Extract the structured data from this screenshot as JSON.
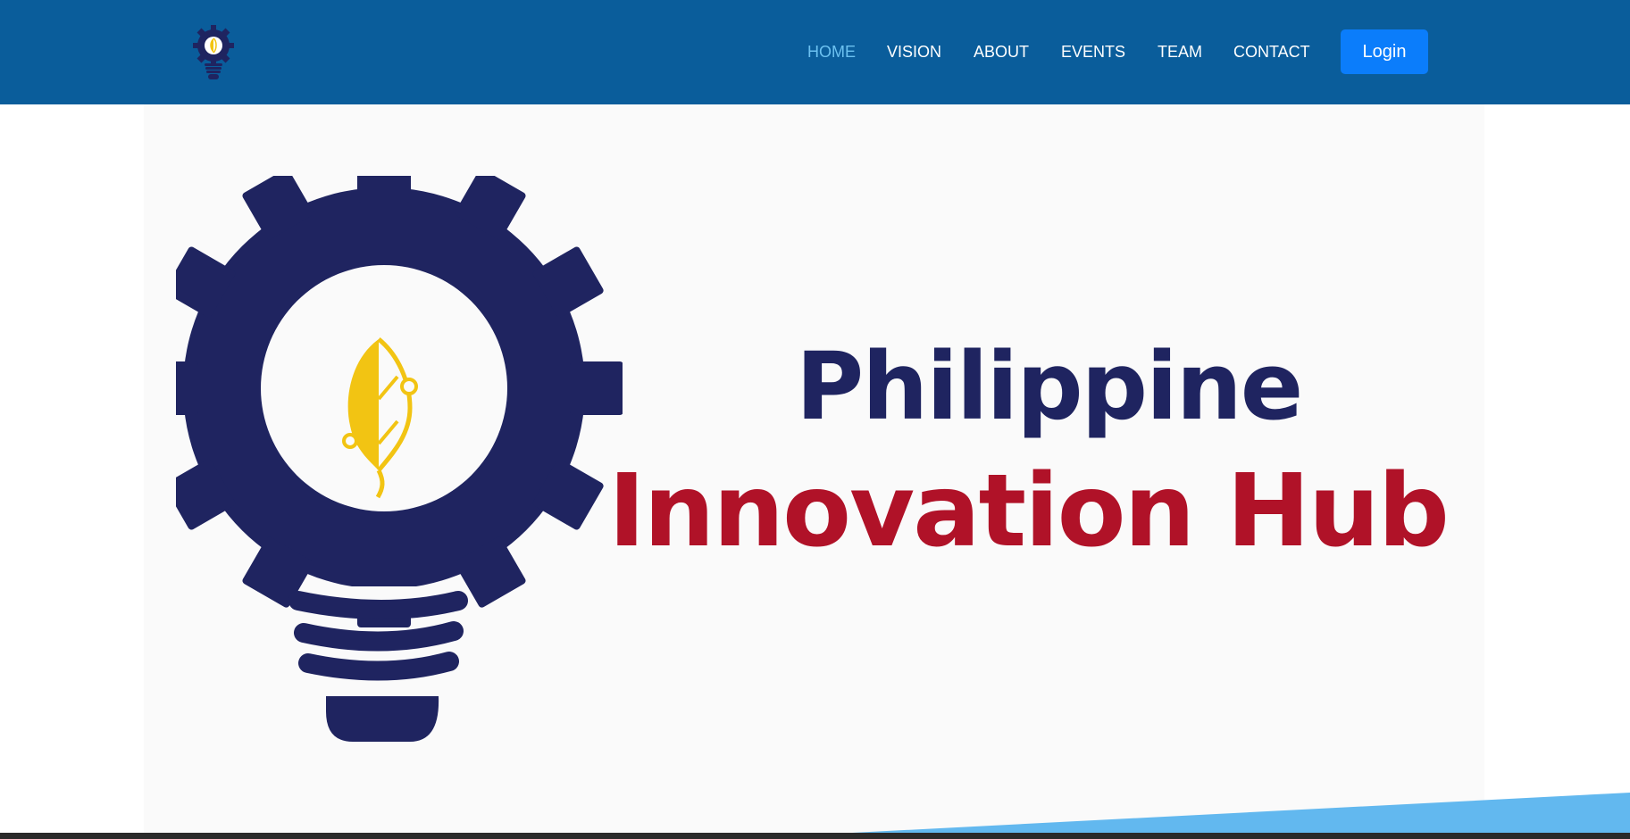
{
  "brand": {
    "logo_icon": "gear-lightbulb-leaf-icon",
    "colors": {
      "header": "#0a5d9b",
      "nav_active": "#6cc1f0",
      "login": "#0b7dfb",
      "navy": "#1f2460",
      "red": "#b01228",
      "gold": "#f2c413",
      "sky": "#62b8ef"
    }
  },
  "nav": {
    "items": [
      {
        "label": "HOME",
        "active": true
      },
      {
        "label": "VISION",
        "active": false
      },
      {
        "label": "ABOUT",
        "active": false
      },
      {
        "label": "EVENTS",
        "active": false
      },
      {
        "label": "TEAM",
        "active": false
      },
      {
        "label": "CONTACT",
        "active": false
      }
    ],
    "login_label": "Login"
  },
  "hero": {
    "title_line1": "Philippine",
    "title_line2": "Innovation Hub"
  }
}
